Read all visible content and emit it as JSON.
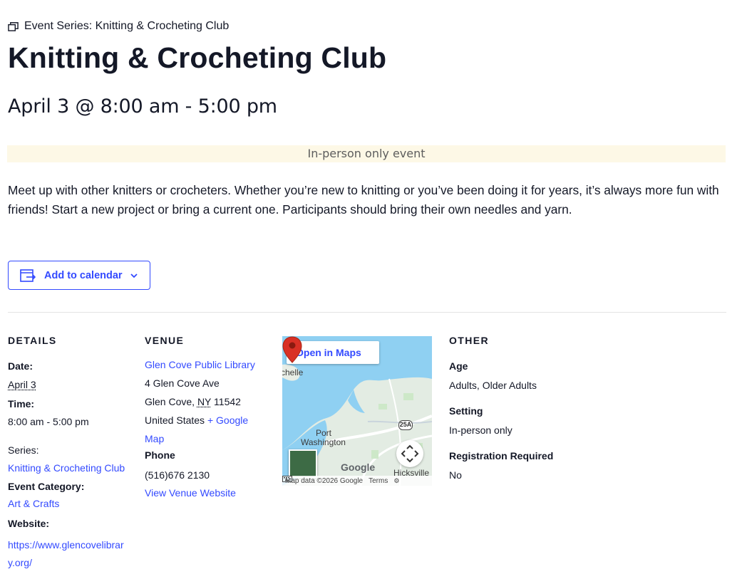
{
  "header": {
    "series_prefix": "Event Series:",
    "series_name": "Knitting & Crocheting Club",
    "title": "Knitting & Crocheting Club",
    "datetime": "April 3 @ 8:00 am - 5:00 pm",
    "attendance_banner": "In-person only event"
  },
  "description": "Meet up with other knitters or crocheters. Whether you’re new to knitting or you’ve been doing it for years, it’s always more fun with friends!   Start a new project or bring a current one. Participants should bring their own needles and yarn.",
  "calendar_button": {
    "label": "Add to calendar",
    "icon": "calendar-export-icon"
  },
  "details": {
    "heading": "DETAILS",
    "date_label": "Date:",
    "date_value": "April 3",
    "time_label": "Time:",
    "time_value": "8:00 am - 5:00 pm",
    "series_label": "Series:",
    "series_link": "Knitting & Crocheting Club",
    "category_label": "Event Category:",
    "category_link": "Art & Crafts",
    "website_label": "Website:",
    "website_link": "https://www.glencovelibrary.org/"
  },
  "venue": {
    "heading": "VENUE",
    "name": "Glen Cove Public Library",
    "street": "4 Glen Cove Ave",
    "city": "Glen Cove,",
    "state": "NY",
    "zip": "11542",
    "country": "United States",
    "map_link_prefix": "+ Google",
    "map_link_suffix": "Map",
    "phone_label": "Phone",
    "phone_value": "(516)676 2130",
    "website_link": "View Venue Website"
  },
  "map": {
    "open_label": "Open in Maps",
    "labels": {
      "chelle": "chelle",
      "port": "Port",
      "washington": "Washington",
      "hicksville": "Hicksville",
      "route_25a": "25A",
      "google": "Google"
    },
    "footer": {
      "data": "Map data ©2026 Google",
      "terms": "Terms"
    }
  },
  "other": {
    "heading": "OTHER",
    "age_label": "Age",
    "age_value": "Adults, Older Adults",
    "setting_label": "Setting",
    "setting_value": "In-person only",
    "registration_label": "Registration Required",
    "registration_value": "No"
  },
  "colors": {
    "accent": "#334aff",
    "text": "#141827",
    "banner_bg": "#fdf8e6",
    "map_water": "#8fd0f2",
    "map_pin": "#d93025"
  }
}
